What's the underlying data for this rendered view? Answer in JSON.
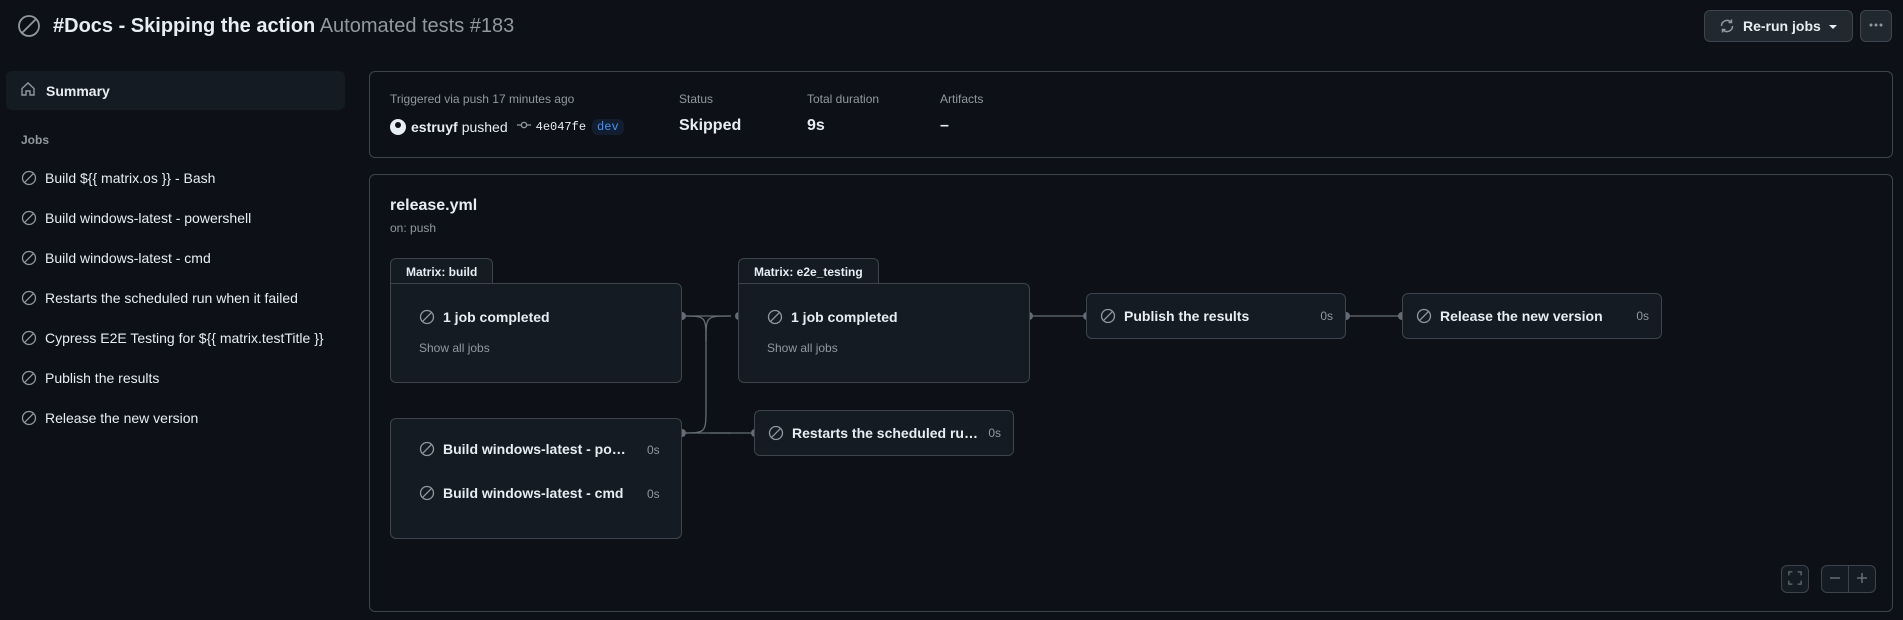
{
  "header": {
    "title_bold": "#Docs - Skipping the action",
    "title_muted": "Automated tests #183",
    "rerun_label": "Re-run jobs"
  },
  "sidebar": {
    "summary_label": "Summary",
    "jobs_heading": "Jobs",
    "jobs": [
      {
        "label": "Build ${{ matrix.os }} - Bash"
      },
      {
        "label": "Build windows-latest - powershell"
      },
      {
        "label": "Build windows-latest - cmd"
      },
      {
        "label": "Restarts the scheduled run when it failed"
      },
      {
        "label": "Cypress E2E Testing for ${{ matrix.testTitle }}"
      },
      {
        "label": "Publish the results"
      },
      {
        "label": "Release the new version"
      }
    ]
  },
  "summary": {
    "trigger_text": "Triggered via push 17 minutes ago",
    "actor": "estruyf",
    "action": "pushed",
    "commit": "4e047fe",
    "branch": "dev",
    "status_label": "Status",
    "status_value": "Skipped",
    "duration_label": "Total duration",
    "duration_value": "9s",
    "artifacts_label": "Artifacts",
    "artifacts_value": "–"
  },
  "graph": {
    "workflow_file": "release.yml",
    "trigger": "on: push",
    "matrix_build": {
      "tab": "Matrix: build",
      "summary": "1 job completed",
      "show_all": "Show all jobs"
    },
    "matrix_e2e": {
      "tab": "Matrix: e2e_testing",
      "summary": "1 job completed",
      "show_all": "Show all jobs"
    },
    "publish": {
      "label": "Publish the results",
      "duration": "0s"
    },
    "release": {
      "label": "Release the new version",
      "duration": "0s"
    },
    "windows_group": [
      {
        "label": "Build windows-latest - powershell",
        "duration": "0s"
      },
      {
        "label": "Build windows-latest - cmd",
        "duration": "0s"
      }
    ],
    "restarts": {
      "label": "Restarts the scheduled run when it failed",
      "duration": "0s"
    }
  },
  "colors": {
    "background": "#0d1117",
    "card_bg": "#151b23",
    "border": "#3d444d",
    "text": "#e6edf3",
    "muted": "#9198a1",
    "branch": "#4493f8"
  }
}
